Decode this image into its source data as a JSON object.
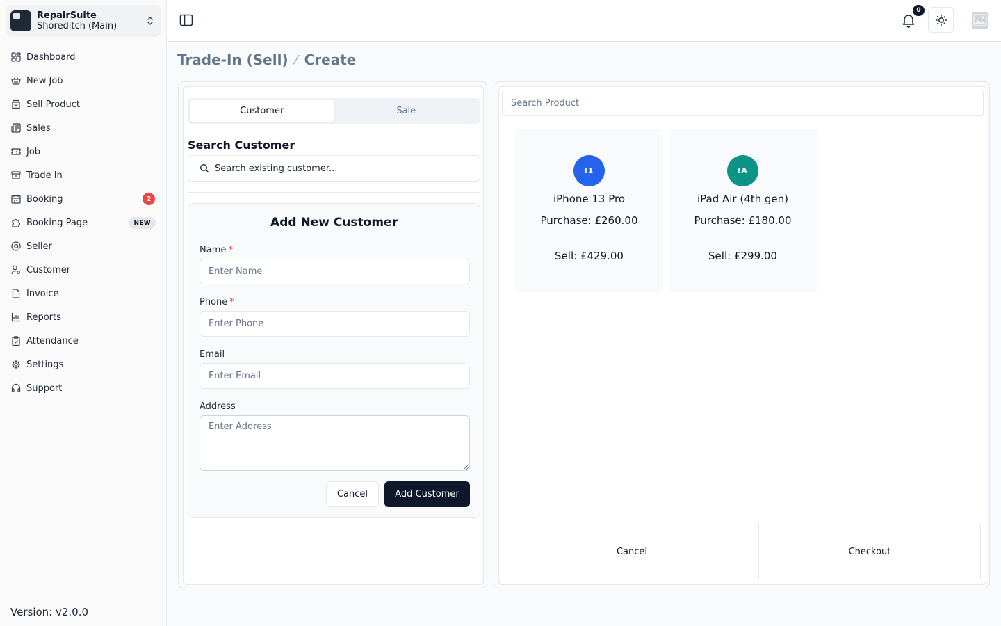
{
  "store": {
    "name": "RepairSuite",
    "branch": "Shoreditch (Main)"
  },
  "sidebar": {
    "items": [
      {
        "label": "Dashboard",
        "icon": "dashboard-icon"
      },
      {
        "label": "New Job",
        "icon": "basket-icon"
      },
      {
        "label": "Sell Product",
        "icon": "shopping-bag-icon"
      },
      {
        "label": "Sales",
        "icon": "receipt-icon"
      },
      {
        "label": "Job",
        "icon": "ticket-icon"
      },
      {
        "label": "Trade In",
        "icon": "archive-icon"
      },
      {
        "label": "Booking",
        "icon": "calendar-icon",
        "badge": "2"
      },
      {
        "label": "Booking Page",
        "icon": "puzzle-icon",
        "badge": "NEW"
      },
      {
        "label": "Seller",
        "icon": "at-sign-icon"
      },
      {
        "label": "Customer",
        "icon": "user-cog-icon"
      },
      {
        "label": "Invoice",
        "icon": "file-icon"
      },
      {
        "label": "Reports",
        "icon": "chart-icon"
      },
      {
        "label": "Attendance",
        "icon": "clipboard-check-icon"
      },
      {
        "label": "Settings",
        "icon": "gear-icon"
      },
      {
        "label": "Support",
        "icon": "headphones-icon"
      }
    ],
    "version": "Version: v2.0.0"
  },
  "header": {
    "notifications_count": "0"
  },
  "breadcrumb": {
    "parent": "Trade-In (Sell)",
    "current": "Create"
  },
  "left": {
    "tabs": [
      "Customer",
      "Sale"
    ],
    "search_title": "Search Customer",
    "search_placeholder": "Search existing customer...",
    "form": {
      "title": "Add New Customer",
      "name_label": "Name",
      "name_placeholder": "Enter Name",
      "phone_label": "Phone",
      "phone_placeholder": "Enter Phone",
      "email_label": "Email",
      "email_placeholder": "Enter Email",
      "address_label": "Address",
      "address_placeholder": "Enter Address",
      "required_mark": "*",
      "cancel_label": "Cancel",
      "submit_label": "Add Customer"
    }
  },
  "right": {
    "search_placeholder": "Search Product",
    "products": [
      {
        "initials": "I1",
        "name": "iPhone 13 Pro",
        "purchase": "Purchase: £260.00",
        "sell": "Sell: £429.00",
        "color": "#2563eb"
      },
      {
        "initials": "IA",
        "name": "iPad Air (4th gen)",
        "purchase": "Purchase: £180.00",
        "sell": "Sell: £299.00",
        "color": "#0d9488"
      }
    ],
    "cancel_label": "Cancel",
    "checkout_label": "Checkout"
  }
}
